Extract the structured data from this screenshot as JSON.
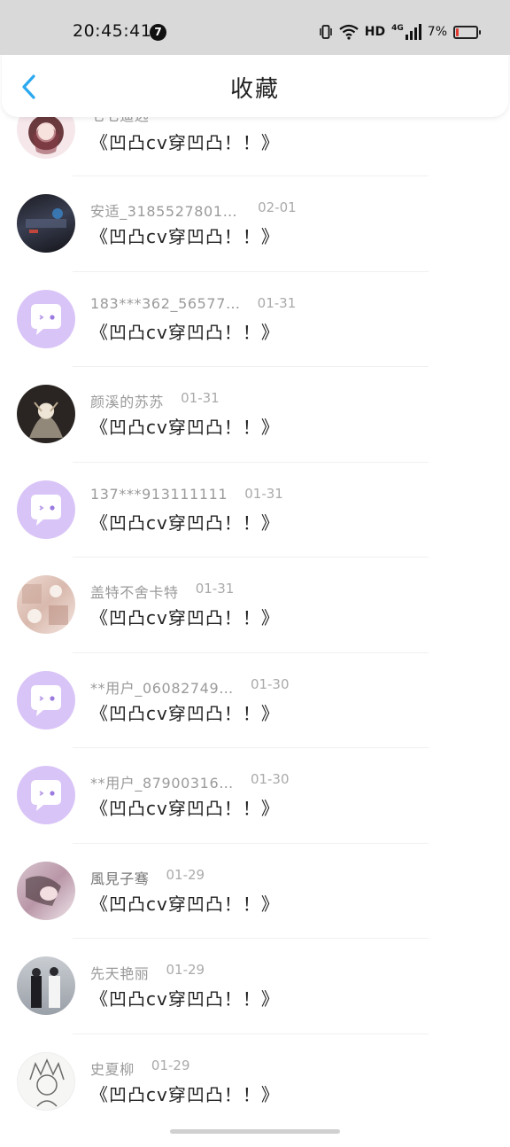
{
  "status_bar": {
    "time": "20:45:41",
    "notification_count": "7",
    "network_label": "HD",
    "signal_label": "4G",
    "battery_percent": "7%"
  },
  "header": {
    "back_icon": "chevron-left-icon",
    "title": "收藏",
    "accent_color": "#2aa8f0"
  },
  "message_text": "《凹凸cv穿凹凸！！》",
  "items": [
    {
      "name": "七七遥远",
      "date": "",
      "avatar": "anime-girl"
    },
    {
      "name": "安适_31855278017…",
      "date": "02-01",
      "avatar": "dark-landscape"
    },
    {
      "name": "183***362_56577…",
      "date": "01-31",
      "avatar": "default-chat"
    },
    {
      "name": "颜溪的苏苏",
      "date": "01-31",
      "avatar": "dark-illustration"
    },
    {
      "name": "137***913111111",
      "date": "01-31",
      "avatar": "default-chat"
    },
    {
      "name": "盖特不舍卡特",
      "date": "01-31",
      "avatar": "cute-collage"
    },
    {
      "name": "**用户_06082749…",
      "date": "01-30",
      "avatar": "default-chat"
    },
    {
      "name": "**用户_87900316…",
      "date": "01-30",
      "avatar": "default-chat"
    },
    {
      "name": "風見子骞",
      "date": "01-29",
      "avatar": "portrait-girl"
    },
    {
      "name": "先天艳丽",
      "date": "01-29",
      "avatar": "couple-photo"
    },
    {
      "name": "史夏柳",
      "date": "01-29",
      "avatar": "sketch-anime"
    }
  ],
  "colors": {
    "default_avatar_bg": "#d9c4f7",
    "status_bar_bg": "#d9d9d9",
    "battery_low": "#e33b32"
  }
}
